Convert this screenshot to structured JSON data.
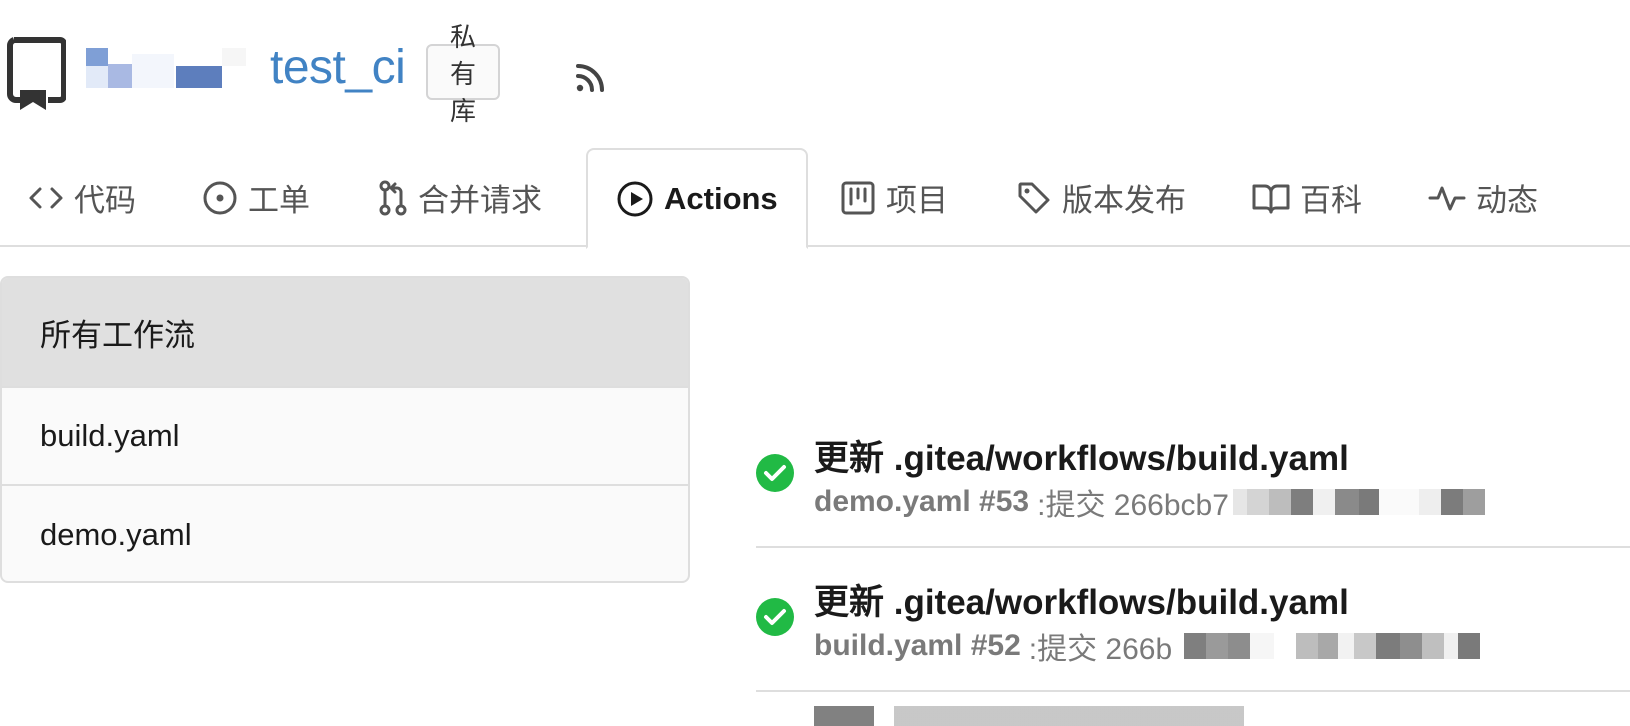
{
  "repo": {
    "name": "test_ci",
    "visibility_badge": "私有库"
  },
  "tabs": [
    {
      "label": "代码",
      "icon": "code-icon"
    },
    {
      "label": "工单",
      "icon": "issue-icon"
    },
    {
      "label": "合并请求",
      "icon": "pull-request-icon"
    },
    {
      "label": "Actions",
      "icon": "play-icon",
      "active": true
    },
    {
      "label": "项目",
      "icon": "project-icon"
    },
    {
      "label": "版本发布",
      "icon": "tag-icon"
    },
    {
      "label": "百科",
      "icon": "book-icon"
    },
    {
      "label": "动态",
      "icon": "pulse-icon"
    }
  ],
  "workflows": {
    "all_label": "所有工作流",
    "items": [
      "build.yaml",
      "demo.yaml"
    ]
  },
  "runs": [
    {
      "title": "更新 .gitea/workflows/build.yaml",
      "workflow_run": "demo.yaml #53",
      "commit_prefix": ":提交 266bcb7",
      "status": "success"
    },
    {
      "title": "更新 .gitea/workflows/build.yaml",
      "workflow_run": "build.yaml #52",
      "commit_prefix": ":提交 266b",
      "status": "success"
    }
  ],
  "colors": {
    "link": "#4183c4",
    "success": "#21ba45",
    "border": "#dedede"
  }
}
